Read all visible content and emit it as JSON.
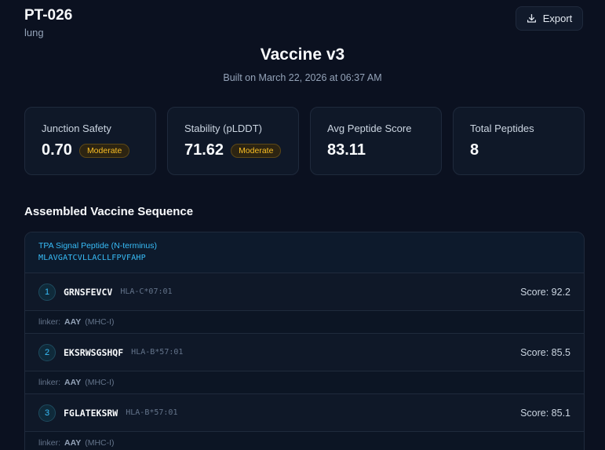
{
  "patient": {
    "id": "PT-026",
    "type": "lung"
  },
  "export_label": "Export",
  "vaccine": {
    "title": "Vaccine v3",
    "built": "Built on March 22, 2026 at 06:37 AM"
  },
  "stats": [
    {
      "label": "Junction Safety",
      "value": "0.70",
      "badge": "Moderate"
    },
    {
      "label": "Stability (pLDDT)",
      "value": "71.62",
      "badge": "Moderate"
    },
    {
      "label": "Avg Peptide Score",
      "value": "83.11"
    },
    {
      "label": "Total Peptides",
      "value": "8"
    }
  ],
  "section_title": "Assembled Vaccine Sequence",
  "signal": {
    "label": "TPA Signal Peptide (N-terminus)",
    "sequence": "MLAVGATCVLLACLLFPVFAHP"
  },
  "peptides": [
    {
      "num": "1",
      "sequence": "GRNSFEVCV",
      "hla": "HLA-C*07:01",
      "score": "Score: 92.2"
    },
    {
      "num": "2",
      "sequence": "EKSRWSGSHQF",
      "hla": "HLA-B*57:01",
      "score": "Score: 85.5"
    },
    {
      "num": "3",
      "sequence": "FGLATEKSRW",
      "hla": "HLA-B*57:01",
      "score": "Score: 85.1"
    }
  ],
  "linkers": [
    {
      "prefix": "linker:",
      "sequence": "AAY",
      "type": "(MHC-I)"
    },
    {
      "prefix": "linker:",
      "sequence": "AAY",
      "type": "(MHC-I)"
    },
    {
      "prefix": "linker:",
      "sequence": "AAY",
      "type": "(MHC-I)"
    }
  ],
  "colors": {
    "accent": "#38bdf8",
    "badge": "#fbbf24",
    "background": "#0b1120"
  },
  "icons": {
    "export": "download-icon"
  }
}
